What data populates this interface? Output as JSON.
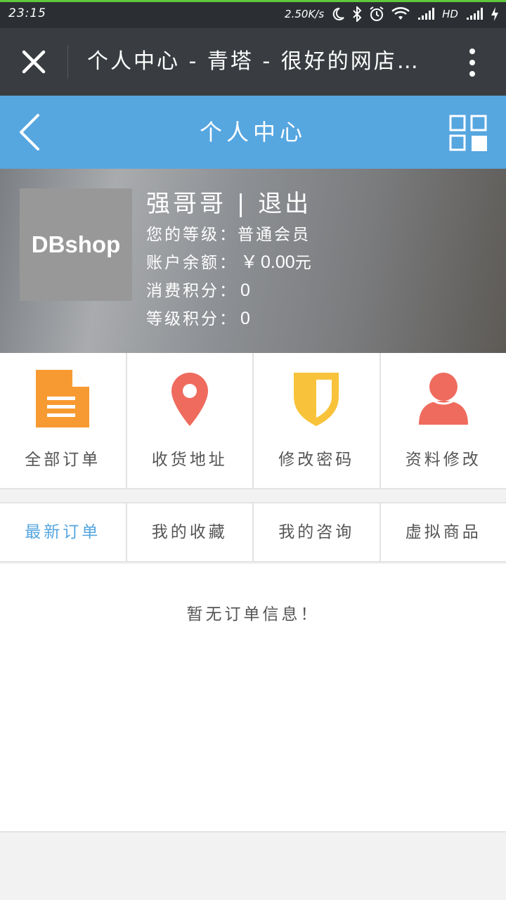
{
  "status_bar": {
    "time": "23:15",
    "network_speed": "2.50K/s",
    "network_type": "HD",
    "icons": [
      "moon-icon",
      "bluetooth-icon",
      "alarm-icon",
      "wifi-icon",
      "signal-icon",
      "signal-icon",
      "charging-icon"
    ]
  },
  "webview": {
    "title": "个人中心 - 青塔 - 很好的网店系统",
    "close_icon": "close-icon",
    "more_icon": "more-vertical-icon"
  },
  "header": {
    "title": "个人中心",
    "back_icon": "chevron-left-icon",
    "menu_icon": "grid-icon"
  },
  "profile": {
    "avatar_text": "DBshop",
    "username": "强哥哥",
    "separator": "|",
    "logout": "退出",
    "level_label": "您的等级：",
    "level_value": "普通会员",
    "balance_label": "账户余额：",
    "balance_currency": "￥",
    "balance_value": "0.00",
    "balance_unit": "元",
    "consume_points_label": "消费积分：",
    "consume_points_value": "0",
    "level_points_label": "等级积分：",
    "level_points_value": "0"
  },
  "actions": [
    {
      "label": "全部订单",
      "icon": "document-icon",
      "color": "#f89a32"
    },
    {
      "label": "收货地址",
      "icon": "map-pin-icon",
      "color": "#ef6b5e"
    },
    {
      "label": "修改密码",
      "icon": "shield-icon",
      "color": "#f8c33a"
    },
    {
      "label": "资料修改",
      "icon": "user-icon",
      "color": "#ef6b5e"
    }
  ],
  "watermark": "DBShop",
  "tabs": [
    {
      "label": "最新订单",
      "active": true
    },
    {
      "label": "我的收藏",
      "active": false
    },
    {
      "label": "我的咨询",
      "active": false
    },
    {
      "label": "虚拟商品",
      "active": false
    }
  ],
  "colors": {
    "accent": "#56a6e0",
    "toolbar": "#393d41",
    "statusbar": "#2b2f33"
  },
  "empty_message": "暂无订单信息！"
}
